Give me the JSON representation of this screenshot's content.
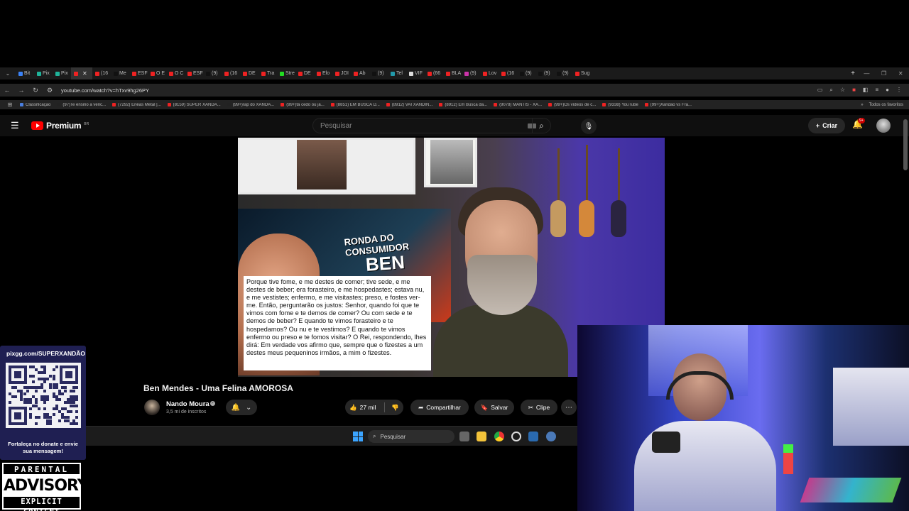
{
  "browser": {
    "tabs": [
      "Bit",
      "Pix",
      "Pix",
      "",
      "(16",
      "Me",
      "ESF",
      "O E",
      "O C",
      "ESF",
      "(9)",
      "(16",
      "DE",
      "Tra",
      "Stre",
      "DE",
      "Elo",
      "JOI",
      "Ab",
      "(9)",
      "Tel",
      "VIF",
      "(66",
      "BLA",
      "(9)",
      "Lov",
      "(16",
      "(9)",
      "(9)",
      "(9)",
      "Sug"
    ],
    "url": "youtube.com/watch?v=hTxv9hg26PY",
    "bookmarks": [
      "Classificação",
      "(97)Te ensino a venc...",
      "(7292) Enéas Metal |...",
      "(8159) SUPER XANDÃ...",
      "(99+)rap do XANDÃ...",
      "(99+)tá cedo ou já...",
      "(8851) EM BUSCA D...",
      "(8912) VAI XANDIN...",
      "(8912) Em Busca da...",
      "(9078) MANTIS - XA...",
      "(99+)Os vídeos de c...",
      "(9338) YouTube",
      "(99+)Xandão vs Fra..."
    ],
    "bookmarks_all": "Todos os favoritos"
  },
  "youtube": {
    "logo_text": "Premium",
    "logo_region": "BR",
    "search_placeholder": "Pesquisar",
    "create_label": "Criar",
    "notification_count": "9+"
  },
  "video": {
    "overlay_title1": "RONDA DO CONSUMIDOR",
    "overlay_title2": "BEN",
    "caption": "Porque tive fome, e me destes de comer; tive sede, e me destes de beber; era forasteiro, e me hospedastes; estava nu, e me vestistes; enfermo, e me visitastes; preso, e fostes ver-me. Então, perguntarão os justos: Senhor, quando foi que te vimos com fome e te demos de comer? Ou com sede e te demos de beber? E quando te vimos forasteiro e te hospedamos? Ou nu e te vestimos? E quando te vimos enfermo ou preso e te fomos visitar? O Rei, respondendo, lhes dirá: Em verdade vos afirmo que, sempre que o fizestes a um destes meus pequeninos irmãos, a mim o fizestes.",
    "title": "Ben Mendes - Uma Felina AMOROSA",
    "channel": "Nando Moura",
    "subscribers": "3,5 mi de inscritos",
    "likes": "27 mil",
    "share_label": "Compartilhar",
    "save_label": "Salvar",
    "clip_label": "Clipe"
  },
  "taskbar": {
    "search_label": "Pesquisar"
  },
  "qr_panel": {
    "url": "pixgg.com/SUPERXANDÃO",
    "message": "Fortaleça no donate e envie sua mensagem!"
  },
  "advisory": {
    "top": "PARENTAL",
    "middle": "ADVISORY",
    "bottom": "EXPLICIT CONTENT"
  },
  "colors": {
    "youtube_red": "#ff0000",
    "qr_panel_bg": "#1f1f52",
    "page_bg": "#0f0f0f"
  }
}
